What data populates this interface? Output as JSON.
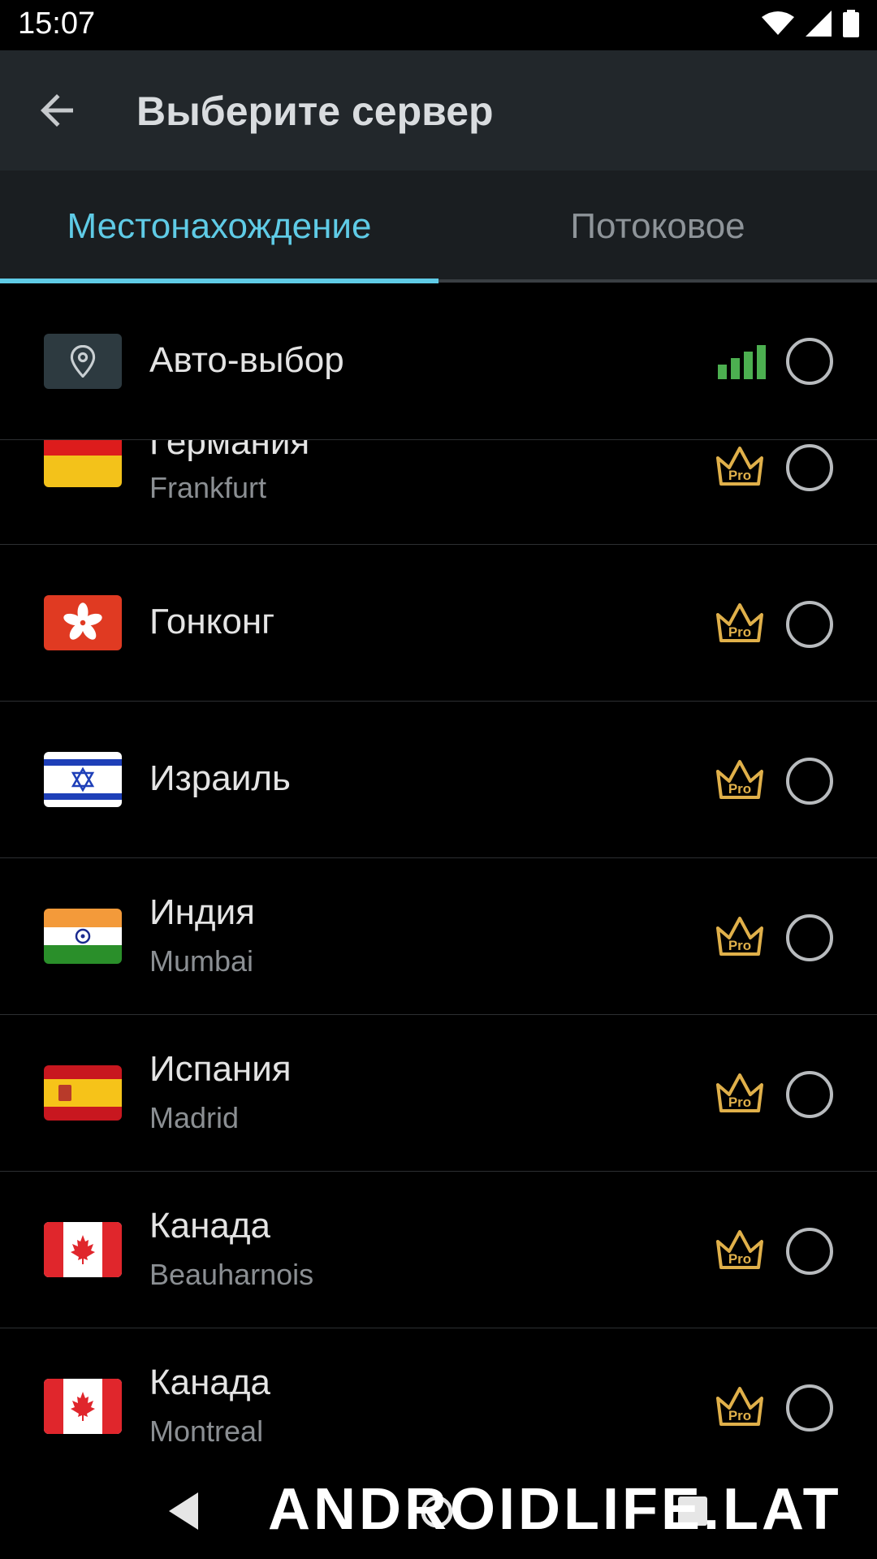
{
  "status_bar": {
    "time": "15:07",
    "icons": [
      "wifi-icon",
      "cell-signal-icon",
      "battery-icon"
    ]
  },
  "app_bar": {
    "title": "Выберите сервер",
    "back_icon": "arrow-back-icon"
  },
  "tabs": [
    {
      "label": "Местонахождение",
      "active": true
    },
    {
      "label": "Потоковое",
      "active": false
    }
  ],
  "servers": [
    {
      "name": "Авто-выбор",
      "city": "",
      "flag": "location-pin-icon",
      "badge": "signal-bars-icon"
    },
    {
      "name": "Германия",
      "city": "Frankfurt",
      "flag": "germany-flag",
      "badge": "Pro"
    },
    {
      "name": "Гонконг",
      "city": "",
      "flag": "hong-kong-flag",
      "badge": "Pro"
    },
    {
      "name": "Израиль",
      "city": "",
      "flag": "israel-flag",
      "badge": "Pro"
    },
    {
      "name": "Индия",
      "city": "Mumbai",
      "flag": "india-flag",
      "badge": "Pro"
    },
    {
      "name": "Испания",
      "city": "Madrid",
      "flag": "spain-flag",
      "badge": "Pro"
    },
    {
      "name": "Канада",
      "city": "Beauharnois",
      "flag": "canada-flag",
      "badge": "Pro"
    },
    {
      "name": "Канада",
      "city": "Montreal",
      "flag": "canada-flag",
      "badge": "Pro"
    }
  ],
  "nav_bar": {
    "icons": [
      "nav-back-icon",
      "nav-home-icon",
      "nav-recents-icon"
    ]
  },
  "watermark": "ANDROIDLIFE.LAT",
  "colors": {
    "accent": "#5fcbe6",
    "pro_gold": "#e0b04a",
    "signal_green": "#4caf50",
    "app_bar": "#22272b"
  }
}
